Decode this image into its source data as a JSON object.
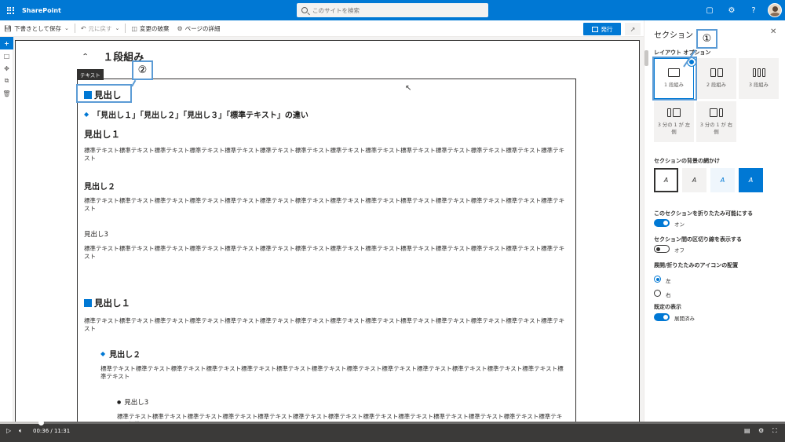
{
  "topbar": {
    "brand": "SharePoint",
    "search_placeholder": "このサイトを検索"
  },
  "cmdbar": {
    "save_draft": "下書きとして保存",
    "undo": "元に戻す",
    "discard": "変更の破棄",
    "page_details": "ページの詳細",
    "publish": "発行"
  },
  "canvas": {
    "section_title": "１段組み",
    "text_label": "テキスト",
    "content": {
      "heading_box": "見出し",
      "diff_heading": "「見出し１」「見出し２」「見出し３」「標準テキスト」の違い",
      "a_h1": "見出し１",
      "a_p1": "標準テキスト標準テキスト標準テキスト標準テキスト標準テキスト標準テキスト標準テキスト標準テキスト標準テキスト標準テキスト標準テキスト標準テキスト標準テキスト標準テキスト",
      "a_h2": "見出し２",
      "a_p2": "標準テキスト標準テキスト標準テキスト標準テキスト標準テキスト標準テキスト標準テキスト標準テキスト標準テキスト標準テキスト標準テキスト標準テキスト標準テキスト標準テキスト",
      "a_h3": "見出し3",
      "a_p3": "標準テキスト標準テキスト標準テキスト標準テキスト標準テキスト標準テキスト標準テキスト標準テキスト標準テキスト標準テキスト標準テキスト標準テキスト標準テキスト標準テキスト",
      "b_h1": "見出し１",
      "b_p1": "標準テキスト標準テキスト標準テキスト標準テキスト標準テキスト標準テキスト標準テキスト標準テキスト標準テキスト標準テキスト標準テキスト標準テキスト標準テキスト標準テキスト",
      "b_h2": "見出し２",
      "b_p2": "標準テキスト標準テキスト標準テキスト標準テキスト標準テキスト標準テキスト標準テキスト標準テキスト標準テキスト標準テキスト標準テキスト標準テキスト標準テキスト標準テキスト",
      "b_h3": "見出し3",
      "b_p3": "標準テキスト標準テキスト標準テキスト標準テキスト標準テキスト標準テキスト標準テキスト標準テキスト標準テキスト標準テキスト標準テキスト標準テキスト標準テキスト標準テキスト"
    }
  },
  "callouts": {
    "one": "①",
    "two": "②"
  },
  "panel": {
    "title": "セクション",
    "layout_label": "レイアウト オプション",
    "layouts": [
      {
        "label": "1 段組み",
        "selected": true
      },
      {
        "label": "2 段組み"
      },
      {
        "label": "3 段組み"
      },
      {
        "label": "3 分の 1 が 左側"
      },
      {
        "label": "3 分の 1 が 右側"
      }
    ],
    "bg_label": "セクションの背景の網かけ",
    "bg_glyph": "A",
    "collapsible_label": "このセクションを折りたたみ可能にする",
    "collapsible_state": "オン",
    "divider_label": "セクション間の区切り線を表示する",
    "divider_state": "オフ",
    "icon_pos_label": "展開/折りたたみのアイコンの配置",
    "icon_pos_left": "左",
    "icon_pos_right": "右",
    "default_label": "既定の表示",
    "default_state": "展開済み"
  },
  "video": {
    "time": "00:36 / 11:31",
    "progress": 0.052
  },
  "colors": {
    "brand": "#0078d4",
    "callout": "#5b9bd5"
  }
}
